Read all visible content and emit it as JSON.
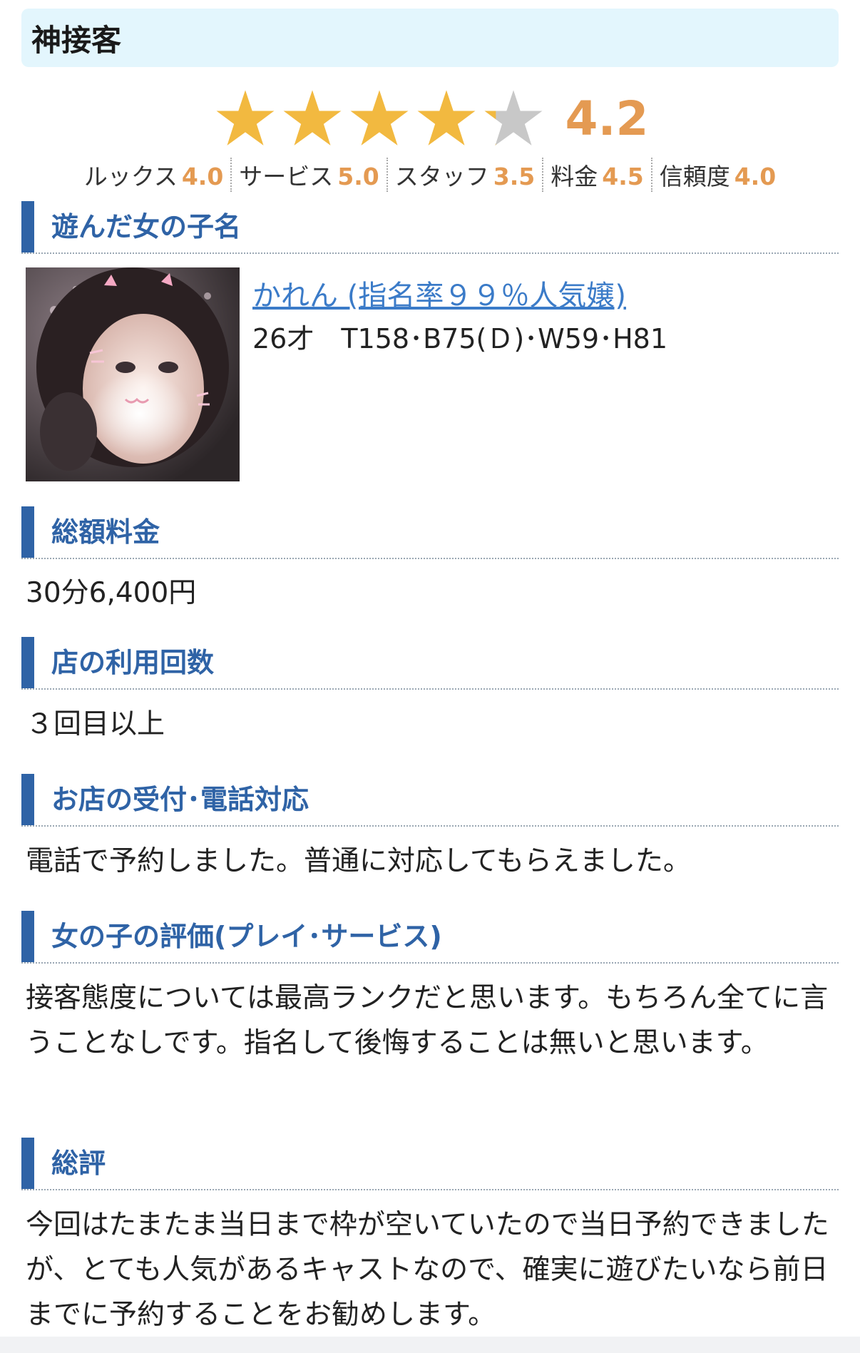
{
  "review": {
    "title": "神接客",
    "overall_rating": "4.2",
    "overall_rating_value": 4.2,
    "star_color": "#f2b940",
    "star_empty_color": "#c8c8c8",
    "sub_ratings": [
      {
        "label": "ルックス",
        "value": "4.0"
      },
      {
        "label": "サービス",
        "value": "5.0"
      },
      {
        "label": "スタッフ",
        "value": "3.5"
      },
      {
        "label": "料金",
        "value": "4.5"
      },
      {
        "label": "信頼度",
        "value": "4.0"
      }
    ]
  },
  "colors": {
    "accent_blue": "#2f63a6",
    "rating_orange": "#e49a52",
    "title_bg": "#e3f6fd",
    "link_blue": "#3b7bc8"
  },
  "sections": {
    "girl_heading": "遊んだ女の子名",
    "girl_name_link": "かれん (指名率９９％人気嬢)",
    "girl_stats": "26才　T158･B75(Ｄ)･W59･H81",
    "price_heading": "総額料金",
    "price_text": "30分6,400円",
    "visits_heading": "店の利用回数",
    "visits_text": "３回目以上",
    "reception_heading": "お店の受付･電話対応",
    "reception_text": "電話で予約しました。普通に対応してもらえました。",
    "girl_eval_heading": "女の子の評価(プレイ･サービス)",
    "girl_eval_text": "接客態度については最高ランクだと思います。もちろん全てに言うことなしです。指名して後悔することは無いと思います。",
    "overall_heading": "総評",
    "overall_text": "今回はたまたま当日まで枠が空いていたので当日予約できましたが、とても人気があるキャストなので、確実に遊びたいなら前日までに予約することをお勧めします。"
  }
}
